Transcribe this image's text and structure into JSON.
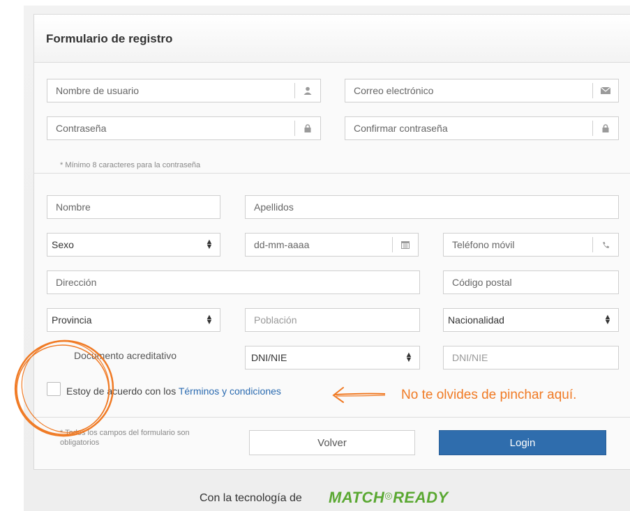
{
  "form": {
    "title": "Formulario de registro",
    "username_placeholder": "Nombre de usuario",
    "email_placeholder": "Correo electrónico",
    "password_placeholder": "Contraseña",
    "confirm_password_placeholder": "Confirmar contraseña",
    "password_hint": "* Mínimo 8 caracteres para la contraseña",
    "first_name_placeholder": "Nombre",
    "last_name_placeholder": "Apellidos",
    "sex_select": "Sexo",
    "birthdate_placeholder": "dd-mm-aaaa",
    "mobile_placeholder": "Teléfono móvil",
    "address_placeholder": "Dirección",
    "postal_code_placeholder": "Código postal",
    "province_select": "Provincia",
    "town_placeholder": "Población",
    "nationality_select": "Nacionalidad",
    "document_label": "Documento acreditativo",
    "document_type_select": "DNI/NIE",
    "document_number_placeholder": "DNI/NIE",
    "agree_text": "Estoy de acuerdo con los ",
    "terms_link": "Términos y condiciones",
    "required_note": "* Todos los campos del formulario son obligatorios",
    "back_button": "Volver",
    "login_button": "Login"
  },
  "annotation": {
    "reminder_text": "No te olvides de pinchar aquí.",
    "color": "#f07a24"
  },
  "footer": {
    "powered_by": "Con la tecnología de",
    "brand": "MATCH READY"
  },
  "icons": {
    "username": "user-icon",
    "email": "envelope-icon",
    "password": "lock-icon",
    "birthdate": "calendar-icon",
    "mobile": "phone-icon",
    "select": "sort-arrows-icon"
  },
  "colors": {
    "primary_button": "#2f6dad",
    "link": "#2a6ab0",
    "brand": "#5aa832"
  }
}
